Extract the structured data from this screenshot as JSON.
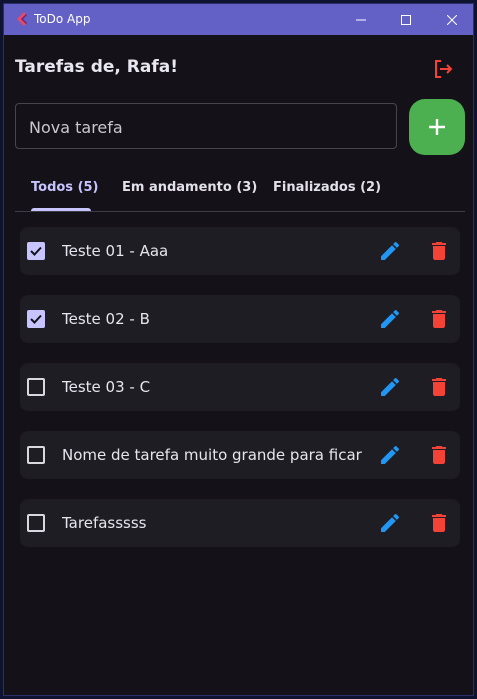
{
  "window": {
    "title": "ToDo App",
    "accent": "#6360c6",
    "controls": [
      "minimize",
      "maximize",
      "close"
    ]
  },
  "header": {
    "title": "Tarefas de, Rafa!",
    "logout_icon": "logout-icon",
    "logout_color": "#f44336"
  },
  "new_task": {
    "value": "",
    "placeholder": "Nova tarefa",
    "add_icon": "plus-icon",
    "add_color": "#4caf50"
  },
  "tabs": [
    {
      "label": "Todos (5)",
      "active": true
    },
    {
      "label": "Em andamento (3)",
      "active": false
    },
    {
      "label": "Finalizados (2)",
      "active": false
    }
  ],
  "tasks": [
    {
      "label": "Teste 01 - Aaa",
      "done": true
    },
    {
      "label": "Teste 02 - B",
      "done": true
    },
    {
      "label": "Teste 03 - C",
      "done": false
    },
    {
      "label": "Nome de tarefa muito grande para ficar",
      "done": false
    },
    {
      "label": "Tarefasssss",
      "done": false
    }
  ],
  "colors": {
    "edit": "#2196f3",
    "delete": "#f44336",
    "checked": "#c7c4ff"
  }
}
